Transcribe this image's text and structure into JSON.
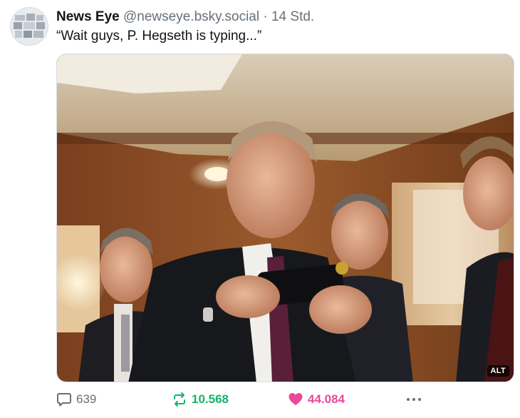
{
  "post": {
    "author": "News Eye",
    "handle": "@newseye.bsky.social",
    "separator": "·",
    "time": "14 Std.",
    "text": "“Wait guys, P. Hegseth is typing...”",
    "media": {
      "alt_badge": "ALT",
      "description": "Photo of men in suits watching a man look at a phone"
    },
    "actions": {
      "replies": "639",
      "reposts": "10.568",
      "likes": "44.084"
    }
  },
  "colors": {
    "repost": "#13b36b",
    "like": "#ec4899",
    "muted": "#66707a"
  },
  "icons": {
    "reply": "speech-bubble-icon",
    "repost": "repost-arrows-icon",
    "like": "heart-icon",
    "more": "more-dots-icon"
  }
}
